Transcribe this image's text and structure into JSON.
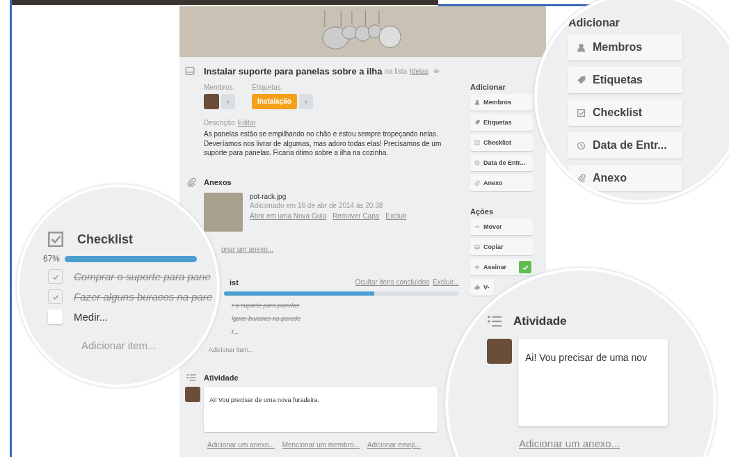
{
  "card": {
    "title": "Instalar suporte para panelas sobre a ilha",
    "list_prefix": "na lista",
    "list_name": "Ideias",
    "members_label": "Membros",
    "labels_label": "Etiquetas",
    "label": "Instalação",
    "add_sign": "+",
    "description_label": "Descrição",
    "edit_link": "Editar",
    "description": "As panelas estão se empilhando no chão e estou sempre tropeçando nelas. Deveríamos nos livrar de algumas, mas adoro todas elas! Precisamos de um suporte para panelas. Ficaria ótimo sobre a ilha na cozinha.",
    "attachments": {
      "heading": "Anexos",
      "name": "pot-rack.jpg",
      "added": "Adicionado em 16 de abr de 2014 às 20:38",
      "links": [
        "Abrir em uma Nova Guia",
        "Remover Capa",
        "Excluir"
      ],
      "add_link": "onar um anexo..."
    },
    "checklist": {
      "heading": "ist",
      "hide_link": "Ocultar itens concluídos",
      "delete_link": "Excluir...",
      "level": 0.64,
      "items": [
        {
          "text": "r o suporte para panelas",
          "checked": true
        },
        {
          "text": "lguns buracos na parede",
          "checked": true
        },
        {
          "text": "r...",
          "checked": false
        }
      ],
      "add_item": "Adicionar item..."
    },
    "activity": {
      "heading": "Atividade",
      "comment": "Ai! Vou precisar de uma nova furadeira.",
      "links": [
        "Adicionar um anexo...",
        "Mencionar um membro...",
        "Adicionar emoji..."
      ]
    }
  },
  "sidebar": [
    {
      "heading": "Adicionar",
      "buttons": [
        {
          "label": "Membros",
          "checked": false
        },
        {
          "label": "Etiquetas",
          "checked": false
        },
        {
          "label": "Checklist",
          "checked": false
        },
        {
          "label": "Data de Entr...",
          "checked": false
        },
        {
          "label": "Anexo",
          "checked": false
        }
      ]
    },
    {
      "heading": "Ações",
      "buttons": [
        {
          "label": "Mover",
          "checked": false
        },
        {
          "label": "Copiar",
          "checked": false
        },
        {
          "label": "Assinar",
          "checked": true
        },
        {
          "label": "V-",
          "checked": false
        }
      ]
    }
  ],
  "zoom_add": {
    "heading": "Adicionar",
    "buttons": [
      "Membros",
      "Etiquetas",
      "Checklist",
      "Data de Entr...",
      "Anexo"
    ]
  },
  "zoom_checklist": {
    "heading": "Checklist",
    "percent": "67%",
    "level": 1,
    "items": [
      {
        "text": "Comprar o suporte para pane",
        "checked": true
      },
      {
        "text": "Fazer alguns buracos na pare",
        "checked": true
      },
      {
        "text": "Medir...",
        "checked": false
      }
    ],
    "add_item": "Adicionar item..."
  },
  "zoom_activity": {
    "heading": "Atividade",
    "comment": "Ai! Vou precisar de uma nov",
    "add_link": "Adicionar um anexo..."
  }
}
